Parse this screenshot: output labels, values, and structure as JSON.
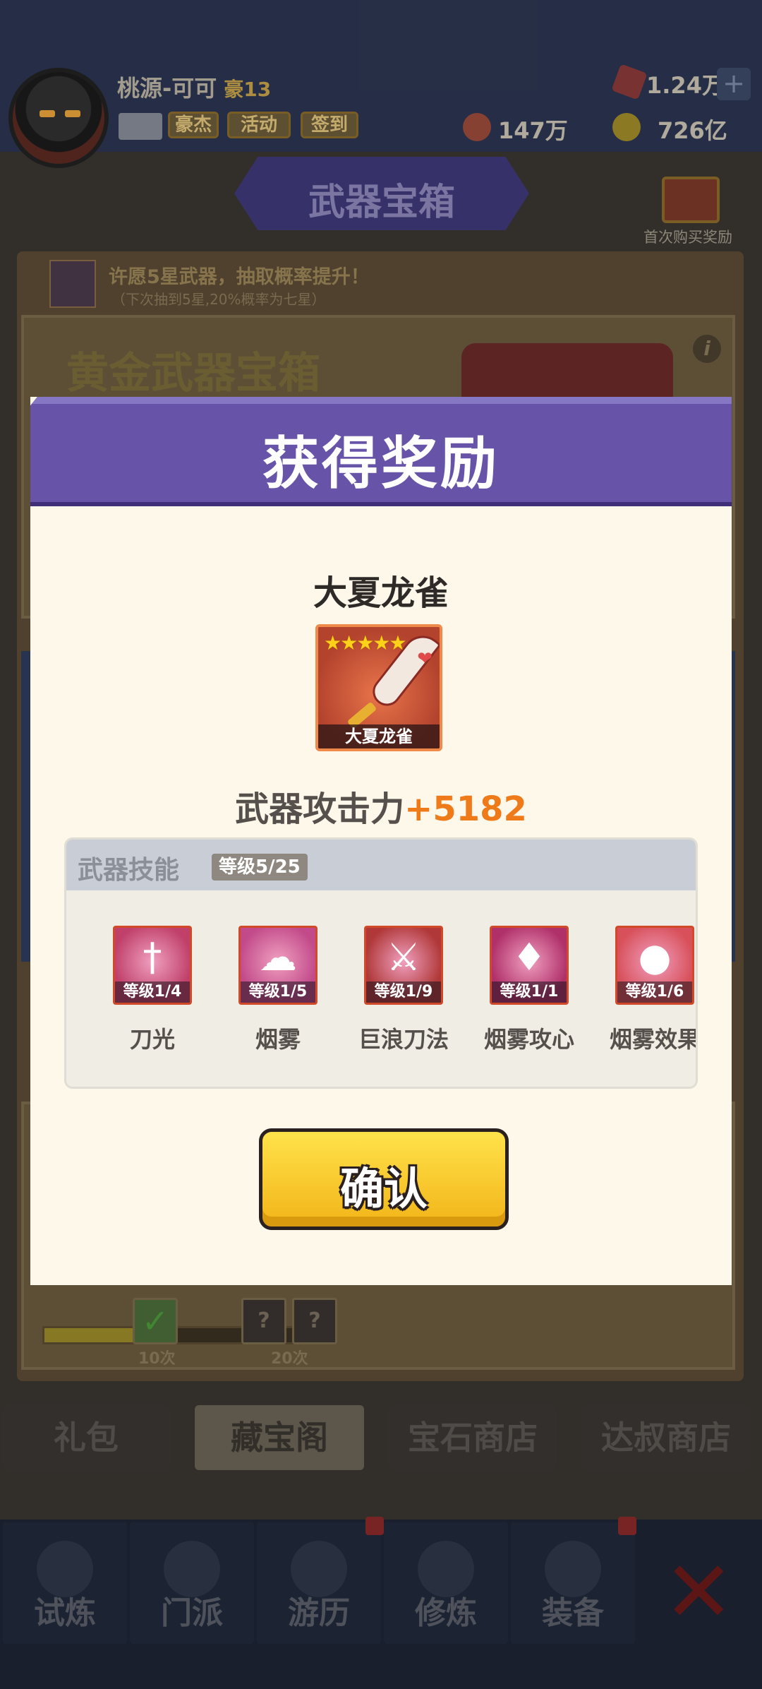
{
  "player": {
    "name": "桃源-可可",
    "rank": "豪13"
  },
  "buttons": {
    "hero": "豪杰",
    "activity": "活动",
    "signin": "签到"
  },
  "resources": {
    "gems": "1.24万",
    "tokens": "147万",
    "coins": "726亿"
  },
  "page_title": "武器宝箱",
  "first_buy_reward": "首次购买奖励",
  "wish": {
    "title": "许愿5星武器，抽取概率提升！",
    "note": "（下次抽到5星,20%概率为七星）"
  },
  "gold_chest_title": "黄金武器宝箱",
  "progress": {
    "counts": [
      "10次",
      "20次"
    ],
    "fill": 0.4
  },
  "shop_tabs": [
    "礼包",
    "藏宝阁",
    "宝石商店",
    "达叔商店"
  ],
  "nav": [
    "试炼",
    "门派",
    "游历",
    "修炼",
    "装备"
  ],
  "modal": {
    "title": "获得奖励",
    "weapon_name": "大夏龙雀",
    "weapon_stars": "★★★★★",
    "weapon_card_label": "大夏龙雀",
    "attack_label": "武器攻击力",
    "attack_value": "+5182",
    "skills_title": "武器技能",
    "skills_level": "等级5/25",
    "skills": [
      {
        "name": "刀光",
        "level": "等级1/4",
        "color": "#c0406a"
      },
      {
        "name": "烟雾",
        "level": "等级1/5",
        "color": "#c24a8a"
      },
      {
        "name": "巨浪刀法",
        "level": "等级1/9",
        "color": "#b03838"
      },
      {
        "name": "烟雾攻心",
        "level": "等级1/1",
        "color": "#b0306a"
      },
      {
        "name": "烟雾效果",
        "level": "等级1/6",
        "color": "#d8505a"
      }
    ],
    "confirm": "确认"
  }
}
